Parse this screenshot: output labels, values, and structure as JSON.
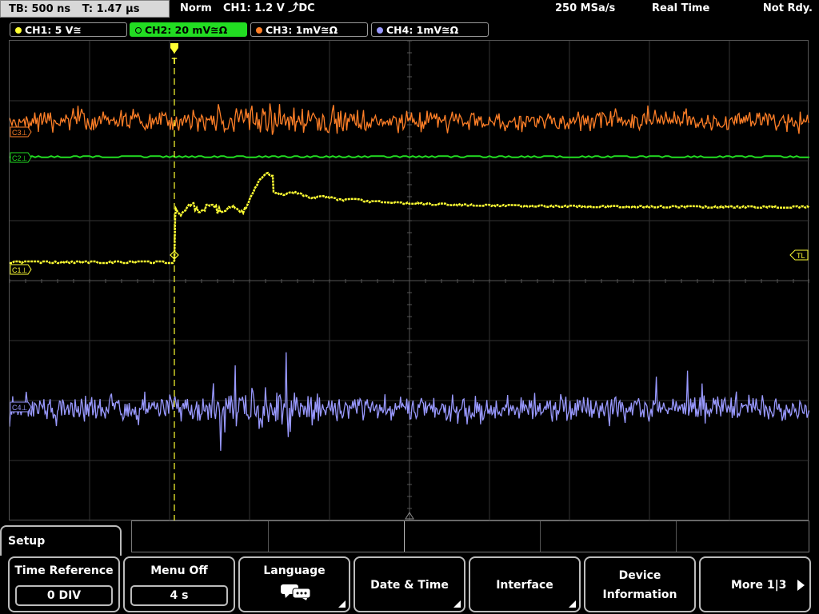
{
  "topbar": {
    "timebase": "TB: 500 ns",
    "trigger_time": "T: 1.47 µs",
    "mode": "Norm",
    "trigger": "CH1: 1.2 V ⤴DC",
    "sample_rate": "250 MSa/s",
    "acq_mode": "Real Time",
    "status": "Not Rdy."
  },
  "channels": [
    {
      "label": "CH1: 5 V≅",
      "color": "#ffff33",
      "active": false
    },
    {
      "label": "CH2: 20 mV≅Ω",
      "color": "#22dd22",
      "active": true
    },
    {
      "label": "CH3: 1mV≅Ω",
      "color": "#ff7f27",
      "active": false
    },
    {
      "label": "CH4: 1mV≅Ω",
      "color": "#9999ff",
      "active": false
    }
  ],
  "markers": {
    "c3": "C3⊥",
    "c2": "C2⊥",
    "c1": "C1⊥",
    "c4": "C4⊥",
    "trigger_level": "TL",
    "trigger_pos": "T"
  },
  "menu": {
    "title": "Setup",
    "softkeys": [
      {
        "label": "Time Reference",
        "value": "0 DIV"
      },
      {
        "label": "Menu Off",
        "value": "4 s"
      },
      {
        "label": "Language",
        "icon": "speech-bubble-icon"
      },
      {
        "label": "Date & Time"
      },
      {
        "label": "Interface"
      },
      {
        "label": "Device",
        "label2": "Information"
      },
      {
        "label": "More 1|3"
      }
    ]
  },
  "colors": {
    "ch1": "#ffff33",
    "ch2": "#22dd22",
    "ch3": "#ff7f27",
    "ch4": "#9999ff",
    "grid": "#3a3a3a"
  }
}
